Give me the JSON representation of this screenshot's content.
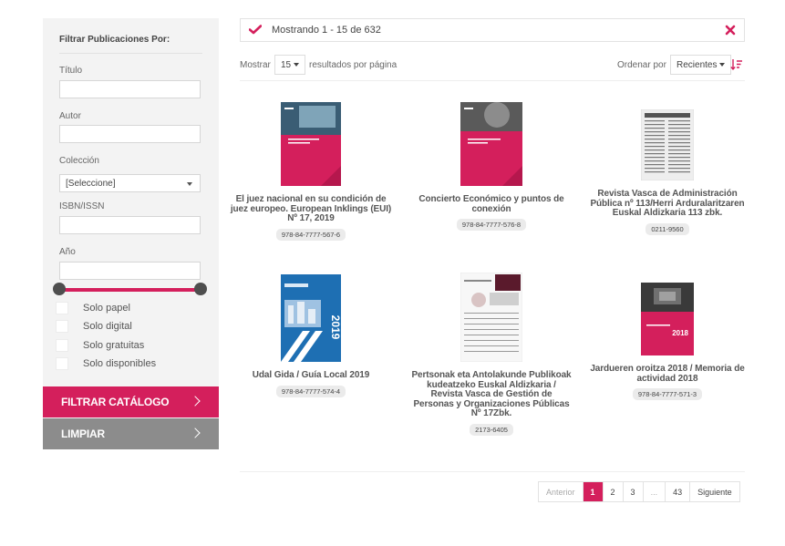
{
  "sidebar": {
    "title": "Filtrar Publicaciones Por:",
    "title_label": "Título",
    "author_label": "Autor",
    "collection_label": "Colección",
    "collection_value": "[Seleccione]",
    "isbn_label": "ISBN/ISSN",
    "year_label": "Año",
    "checkboxes": [
      "Solo papel",
      "Solo digital",
      "Solo gratuitas",
      "Solo disponibles"
    ],
    "filter_button": "FILTRAR CATÁLOGO",
    "clear_button": "LIMPIAR"
  },
  "results": {
    "showing_text": "Mostrando 1 - 15 de 632",
    "show_label": "Mostrar",
    "per_page_value": "15",
    "per_page_suffix": "resultados por página",
    "sort_label": "Ordenar por",
    "sort_value": "Recientes"
  },
  "books": [
    {
      "title": "El juez nacional en su condición de juez europeo. European Inklings (EUI) Nº 17, 2019",
      "isbn": "978-84-7777-567-6",
      "cover_color": "#d41f5c"
    },
    {
      "title": "Concierto Económico y puntos de conexión",
      "isbn": "978-84-7777-576-8",
      "cover_color": "#d41f5c"
    },
    {
      "title": "Revista Vasca de Administración Pública nº 113/Herri Arduralaritzaren Euskal Aldizkaria 113 zbk.",
      "isbn": "0211-9560",
      "cover_color": "#e8e8e8"
    },
    {
      "title": "Udal Gida / Guía Local 2019",
      "isbn": "978-84-7777-574-4",
      "cover_color": "#1e6fb3"
    },
    {
      "title": "Pertsonak eta Antolakunde Publikoak kudeatzeko Euskal Aldizkaria / Revista Vasca de Gestión de Personas y Organizaciones Públicas Nº 17Zbk.",
      "isbn": "2173-6405",
      "cover_color": "#f4f4f4"
    },
    {
      "title": "Jardueren oroitza 2018 / Memoria de actividad 2018",
      "isbn": "978-84-7777-571-3",
      "cover_color": "#d41f5c"
    }
  ],
  "pagination": {
    "prev": "Anterior",
    "pages": [
      "1",
      "2",
      "3",
      "...",
      "43"
    ],
    "next": "Siguiente",
    "current": "1"
  },
  "colors": {
    "accent": "#d41f5c",
    "clear_button": "#8c8c8c",
    "sidebar_bg": "#f3f3f3"
  }
}
